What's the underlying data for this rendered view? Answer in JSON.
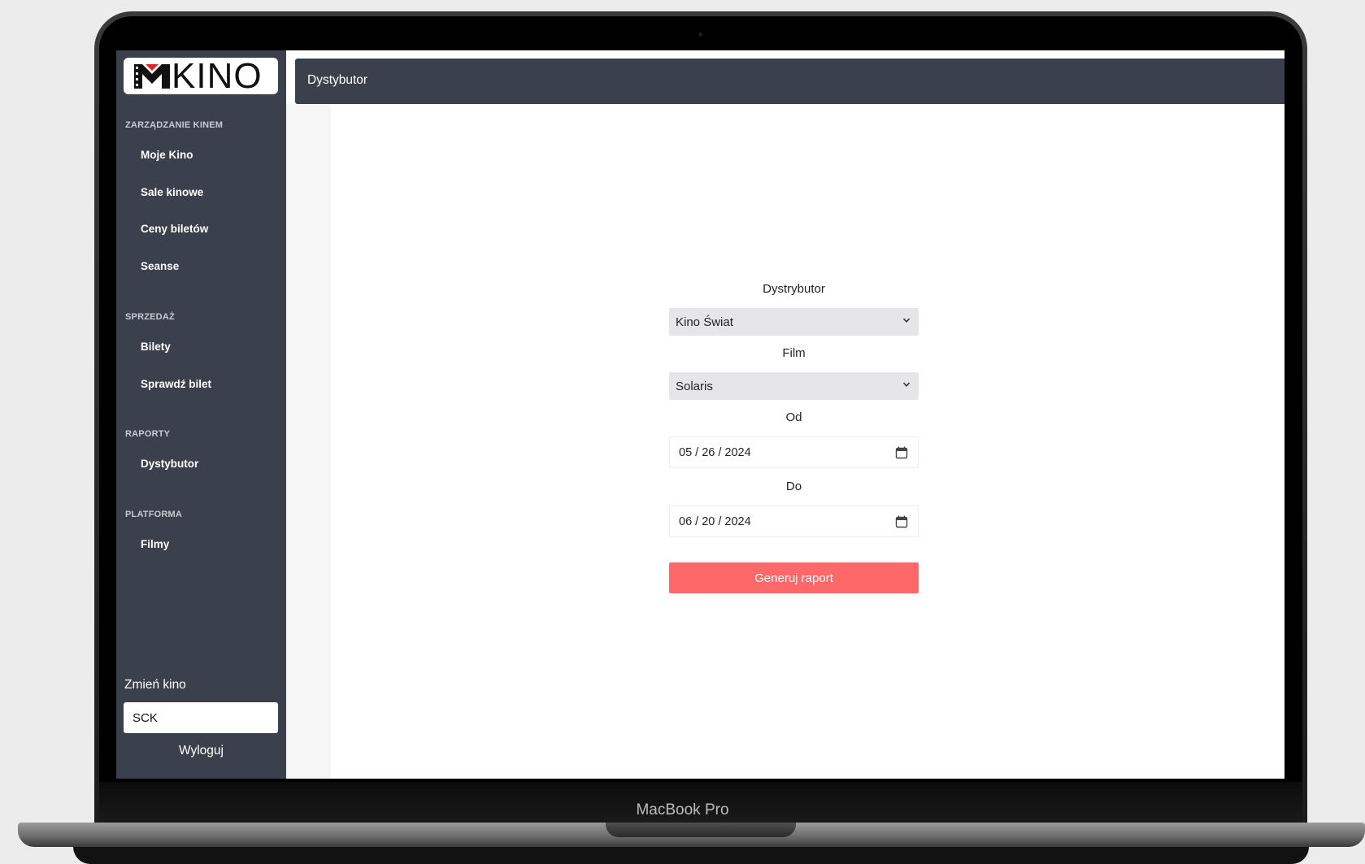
{
  "device": {
    "label": "MacBook Pro"
  },
  "sidebar": {
    "logo_text": "KINO",
    "sections": [
      {
        "title": "ZARZĄDZANIE KINEM",
        "items": [
          "Moje Kino",
          "Sale kinowe",
          "Ceny biletów",
          "Seanse"
        ]
      },
      {
        "title": "SPRZEDAŻ",
        "items": [
          "Bilety",
          "Sprawdź bilet"
        ]
      },
      {
        "title": "RAPORTY",
        "items": [
          "Dystybutor"
        ]
      },
      {
        "title": "PLATFORMA",
        "items": [
          "Filmy"
        ]
      }
    ],
    "change_cinema_label": "Zmień kino",
    "cinema_value": "SCK",
    "logout_label": "Wyloguj"
  },
  "header": {
    "title": "Dystybutor"
  },
  "form": {
    "distributor_label": "Dystrybutor",
    "distributor_value": "Kino Świat",
    "film_label": "Film",
    "film_value": "Solaris",
    "from_label": "Od",
    "from_value": "05 / 26 / 2024",
    "to_label": "Do",
    "to_value": "06 / 20 / 2024",
    "submit_label": "Generuj raport"
  },
  "colors": {
    "sidebar_bg": "#3a404c",
    "accent_button": "#ff6868",
    "select_bg": "#e6e6e9"
  }
}
